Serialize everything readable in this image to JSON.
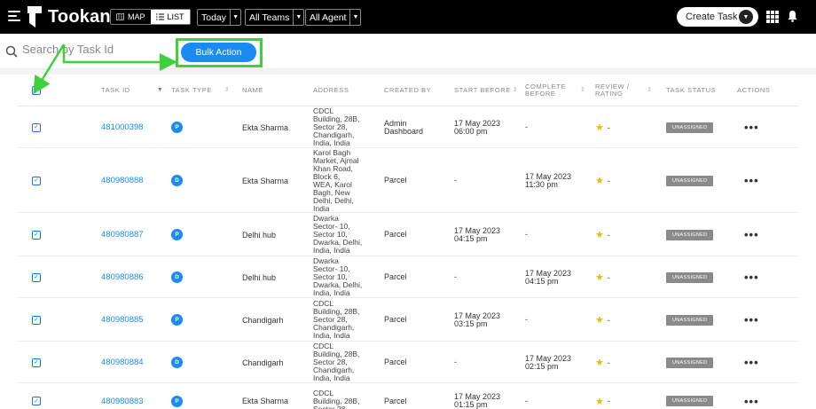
{
  "header": {
    "brand": "Tookan",
    "view_map": "MAP",
    "view_list": "LIST",
    "date_filter": "Today",
    "team_filter": "All Teams",
    "agent_filter": "All Agent",
    "create_task": "Create Task"
  },
  "search": {
    "placeholder": "Search by Task Id"
  },
  "bulk_action": "Bulk Action",
  "columns": {
    "task_id": "TASK ID",
    "task_type": "TASK TYPE",
    "name": "NAME",
    "address": "ADDRESS",
    "created_by": "CREATED BY",
    "start_before": "START BEFORE",
    "complete_before": "COMPLETE\nBEFORE",
    "review": "REVIEW /\nRATING",
    "status": "TASK STATUS",
    "actions": "ACTIONS"
  },
  "rows": [
    {
      "task_id": "481000398",
      "type": "P",
      "name": "Ekta Sharma",
      "address": "CDCL\nBuilding, 28B,\nSector 28,\nChandigarh,\nIndia, India",
      "created_by": "Admin\nDashboard",
      "start_before": "17 May 2023\n06:00 pm",
      "complete_before": "-",
      "rating": "-",
      "status": "UNASSIGNED"
    },
    {
      "task_id": "480980888",
      "type": "D",
      "name": "Ekta Sharma",
      "address": "Karol Bagh\nMarket, Ajmal\nKhan Road,\nBlock 6,\nWEA, Karol\nBagh, New\nDelhi, Delhi,\nIndia",
      "created_by": "Parcel",
      "start_before": "-",
      "complete_before": "17 May 2023\n11:30 pm",
      "rating": "-",
      "status": "UNASSIGNED"
    },
    {
      "task_id": "480980887",
      "type": "P",
      "name": "Delhi hub",
      "address": "Dwarka\nSector- 10,\nSector 10,\nDwarka, Delhi,\nIndia, India",
      "created_by": "Parcel",
      "start_before": "17 May 2023\n04:15 pm",
      "complete_before": "-",
      "rating": "-",
      "status": "UNASSIGNED"
    },
    {
      "task_id": "480980886",
      "type": "D",
      "name": "Delhi hub",
      "address": "Dwarka\nSector- 10,\nSector 10,\nDwarka, Delhi,\nIndia, India",
      "created_by": "Parcel",
      "start_before": "-",
      "complete_before": "17 May 2023\n04:15 pm",
      "rating": "-",
      "status": "UNASSIGNED"
    },
    {
      "task_id": "480980885",
      "type": "P",
      "name": "Chandigarh",
      "address": "CDCL\nBuilding, 28B,\nSector 28,\nChandigarh,\nIndia, India",
      "created_by": "Parcel",
      "start_before": "17 May 2023\n03:15 pm",
      "complete_before": "-",
      "rating": "-",
      "status": "UNASSIGNED"
    },
    {
      "task_id": "480980884",
      "type": "D",
      "name": "Chandigarh",
      "address": "CDCL\nBuilding, 28B,\nSector 28,\nChandigarh,\nIndia, India",
      "created_by": "Parcel",
      "start_before": "-",
      "complete_before": "17 May 2023\n02:15 pm",
      "rating": "-",
      "status": "UNASSIGNED"
    },
    {
      "task_id": "480980883",
      "type": "P",
      "name": "Ekta Sharma",
      "address": "CDCL\nBuilding, 28B,\nSector 28,",
      "created_by": "Parcel",
      "start_before": "17 May 2023\n01:15 pm",
      "complete_before": "-",
      "rating": "-",
      "status": "UNASSIGNED"
    }
  ],
  "colors": {
    "accent": "#1a8bf0",
    "highlight": "#3dd13d",
    "status": "#8a8a8a"
  }
}
